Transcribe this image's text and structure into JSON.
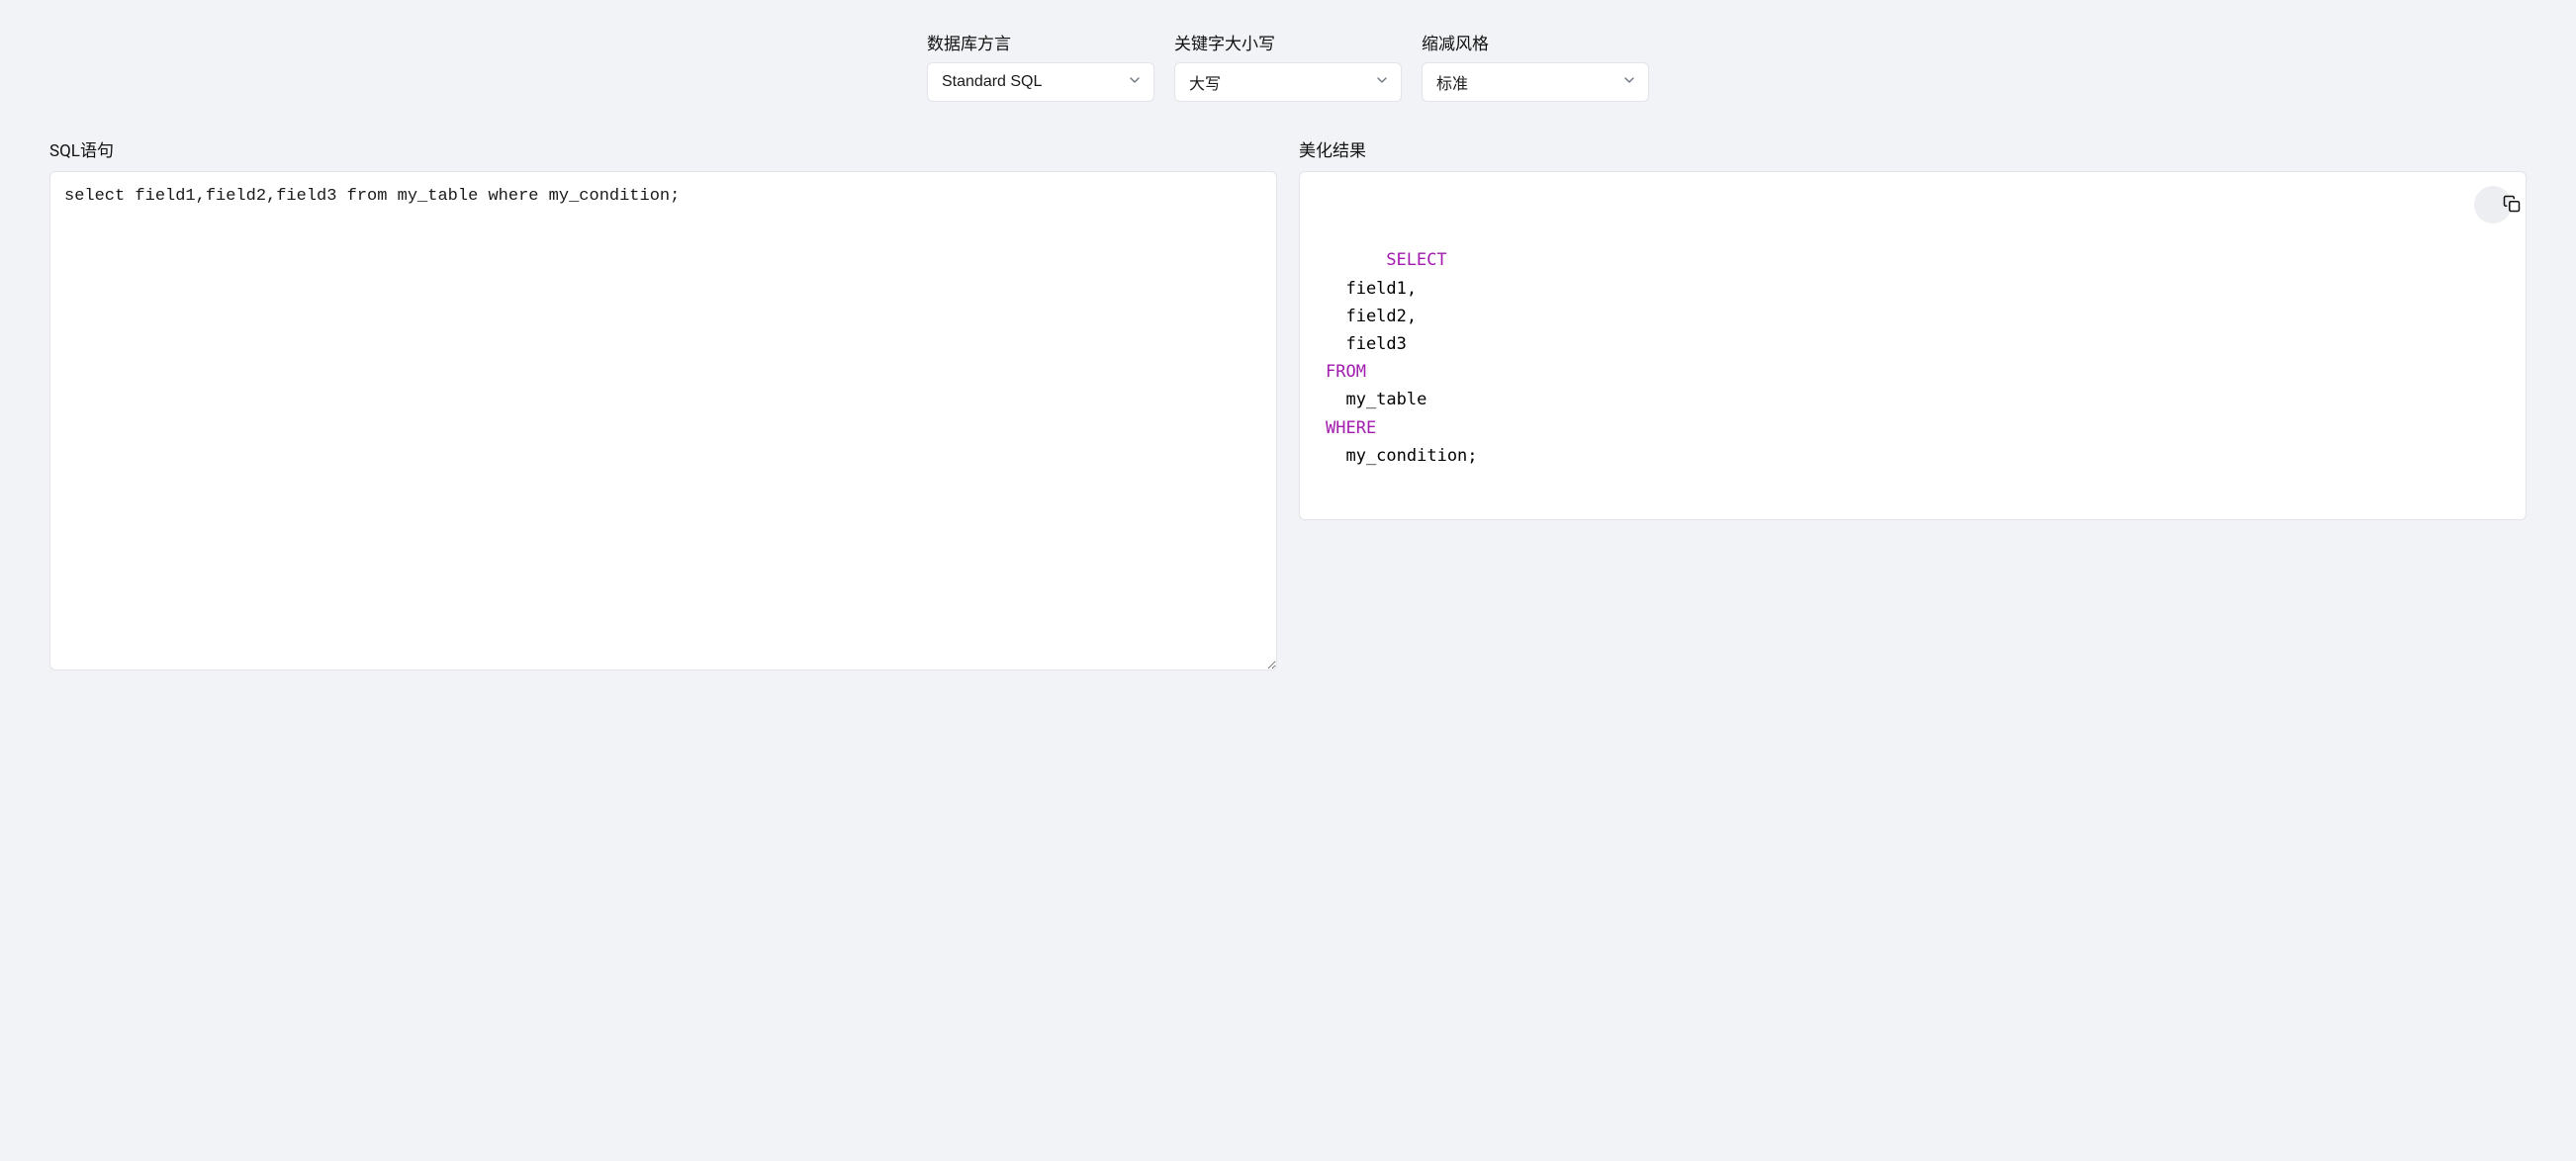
{
  "controls": {
    "dialect": {
      "label": "数据库方言",
      "value": "Standard SQL"
    },
    "keyword_case": {
      "label": "关键字大小写",
      "value": "大写"
    },
    "indent_style": {
      "label": "缩减风格",
      "value": "标准"
    }
  },
  "input": {
    "label": "SQL语句",
    "value": "select field1,field2,field3 from my_table where my_condition;"
  },
  "output": {
    "label": "美化结果",
    "tokens": [
      {
        "type": "kw",
        "text": "SELECT"
      },
      {
        "type": "plain",
        "text": "\n  field1,\n  field2,\n  field3\n"
      },
      {
        "type": "kw",
        "text": "FROM"
      },
      {
        "type": "plain",
        "text": "\n  my_table\n"
      },
      {
        "type": "kw",
        "text": "WHERE"
      },
      {
        "type": "plain",
        "text": "\n  my_condition;"
      }
    ]
  }
}
